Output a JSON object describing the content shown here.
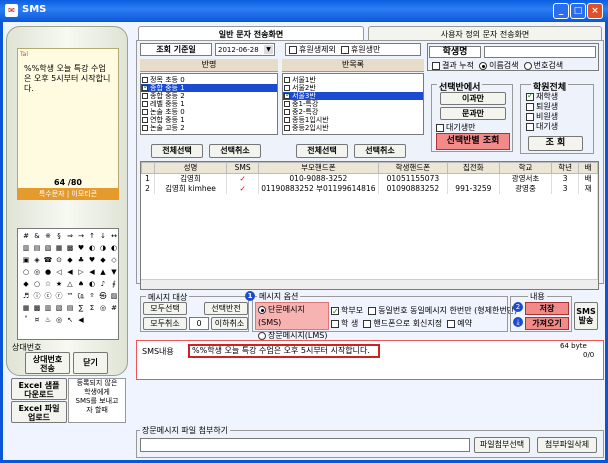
{
  "window": {
    "title": "SMS",
    "min": "_",
    "max": "□",
    "close": "×"
  },
  "phone": {
    "message": "%%학생 오늘 특강 수업은 오후 5시부터 시작합니다.",
    "counter": "64 /80",
    "footer": "특수문자 | 이모티콘",
    "keys": [
      "#",
      "&",
      "※",
      "§",
      "⇒",
      "→",
      "↑",
      "↓",
      "↔",
      "▥",
      "▤",
      "▧",
      "▦",
      "▩",
      "♥",
      "◐",
      "◑",
      "◐",
      "▣",
      "◈",
      "☎",
      "⊙",
      "◆",
      "♣",
      "♥",
      "◆",
      "◇",
      "○",
      "◎",
      "●",
      "◁",
      "◀",
      "▷",
      "◀",
      "▲",
      "▼",
      "◆",
      "○",
      "☆",
      "★",
      "△",
      "♠",
      "◐",
      "♪",
      "∮",
      "♬",
      "ⓘ",
      "ⓒ",
      "ⓡ",
      "™",
      "㏇",
      "º",
      "㉿",
      "▨",
      "▦",
      "▩",
      "▥",
      "▧",
      "▤",
      "∑",
      "Σ",
      "◎",
      "#",
      "˚",
      "¤",
      "♨",
      "◎",
      "↖",
      "◀"
    ],
    "status_label": "상대번호",
    "detail_btn": "상대번호\n전송",
    "close_btn": "닫기"
  },
  "excel": {
    "download": "Excel 샘플\n다운로드",
    "upload": "Excel 파일\n업로드",
    "notice": "등록되지 않은\n학생에게\nSMS를 보내고\n자 할때"
  },
  "tabs": {
    "active": "일반 문자 전송화면",
    "other": "사용자 정의 문자 전송화면"
  },
  "filters": {
    "date_label": "조회 기준일",
    "date_value": "2012-06-28",
    "exclude_leave": "휴원생제외",
    "leave_only": "휴원생만",
    "student_name_label": "학생명",
    "result_accum": "결과 누적",
    "name_search": "이름검색",
    "phone_search": "번호검색"
  },
  "lists": {
    "class_header": "반명",
    "group_header": "반목록",
    "class_items": [
      {
        "text": "정목 초등 0",
        "checked": false
      },
      {
        "text": "종합 중등 1",
        "checked": true
      },
      {
        "text": "종합 중등 2",
        "checked": false
      },
      {
        "text": "레벨 중등 1",
        "checked": false
      },
      {
        "text": "논술 초등 0",
        "checked": false
      },
      {
        "text": "연합 중등 1",
        "checked": false
      },
      {
        "text": "논술 고등 2",
        "checked": false
      }
    ],
    "group_items": [
      {
        "text": "서울1반",
        "checked": false
      },
      {
        "text": "서울2반",
        "checked": false
      },
      {
        "text": "서울3반",
        "checked": true
      },
      {
        "text": "중1-특강",
        "checked": false
      },
      {
        "text": "중2-특강",
        "checked": false
      },
      {
        "text": "종등1입시반",
        "checked": false
      },
      {
        "text": "중등2입시반",
        "checked": false
      }
    ],
    "select_all": "전체선택",
    "deselect": "선택취소"
  },
  "select_panel": {
    "title": "선택반에서",
    "btn1": "이과만",
    "btn2": "문과만",
    "waiting": "대기생만",
    "search_btn": "선택반별 조회"
  },
  "student_status": {
    "title": "학원전체",
    "items": [
      {
        "text": "재학생",
        "checked": true
      },
      {
        "text": "퇴원생",
        "checked": false
      },
      {
        "text": "비원생",
        "checked": false
      },
      {
        "text": "대기생",
        "checked": false
      }
    ],
    "search": "조 회"
  },
  "grid": {
    "headers": [
      "",
      "성명",
      "SMS",
      "부모핸드폰",
      "학생핸드폰",
      "집전화",
      "학교",
      "학년",
      "배"
    ],
    "rows": [
      [
        "1",
        "김영희",
        "✓",
        "010-9088-3252",
        "01051155073",
        "",
        "광영서초",
        "3",
        "배"
      ],
      [
        "2",
        "김영희 kimhee",
        "✓",
        "01190883252 부01199614816",
        "01090883252",
        "991-3259",
        "광영중",
        "3",
        "재"
      ]
    ]
  },
  "message_target": {
    "title": "메시지 대상",
    "all_select": "모두선택",
    "reverse": "선택반전",
    "all_cancel": "모두취소",
    "zero": "0",
    "under_cancel": "이하취소"
  },
  "message_options": {
    "title": "메시지 옵션",
    "sms": "단문메시지(SMS)",
    "lms": "장문메시지(LMS)",
    "parents": "학부모",
    "students": "학 생",
    "same_number": "동일번호 동일메시지 한번만 (형제한번만)",
    "handphone_reply": "핸드폰으로 회신지정",
    "reserve": "예약",
    "badge1": "1",
    "badge2": "2"
  },
  "content": {
    "title": "내용",
    "save": "저장",
    "load": "가져오기",
    "send": "SMS\n발송"
  },
  "sms": {
    "label": "SMS내용",
    "text": "%%학생 오늘 특강 수업은 오후 5시부터 시작합니다.",
    "bytes": "64 byte",
    "count": "0/0"
  },
  "attach": {
    "title": "장문메시지 파일 첨부하기",
    "attach_btn": "파일첨부선택",
    "delete_btn": "첨부파일삭제"
  }
}
